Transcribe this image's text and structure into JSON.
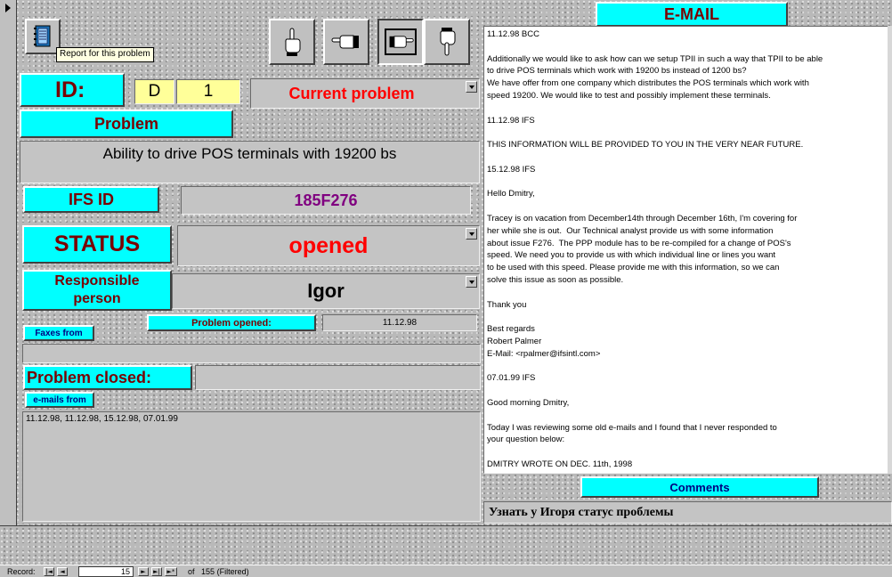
{
  "toolbar": {
    "tooltip": "Report for this problem",
    "buttons": [
      "report-book-icon",
      "pointing-hand-up-icon",
      "pointing-hand-left-icon",
      "pointing-hand-right-icon",
      "pointing-hand-down-icon"
    ]
  },
  "record": {
    "id_label": "ID:",
    "id_prefix": "D",
    "id_number": "1",
    "current_problem": "Current problem",
    "problem_label": "Problem",
    "problem_text": "Ability to drive POS terminals with 19200 bs",
    "ifs_id_label": "IFS ID",
    "ifs_id_value": "185F276",
    "status_label": "STATUS",
    "status_value": "opened",
    "responsible_label": "Responsible person",
    "responsible_value": "Igor",
    "problem_opened_label": "Problem opened:",
    "problem_opened_value": "11.12.98",
    "faxes_label": "Faxes from",
    "faxes_value": "",
    "problem_closed_label": "Problem closed:",
    "problem_closed_value": "",
    "emails_label": "e-mails from",
    "emails_value": "11.12.98, 11.12.98, 15.12.98, 07.01.99"
  },
  "email_panel": {
    "title": "E-MAIL",
    "body": "11.12.98 BCC\n\nAdditionally we would like to ask how can we setup TPII in such a way that TPII to be able\nto drive POS terminals which work with 19200 bs instead of 1200 bs?\nWe have offer from one company which distributes the POS terminals which work with\nspeed 19200. We would like to test and possibly implement these terminals.\n\n11.12.98 IFS\n\nTHIS INFORMATION WILL BE PROVIDED TO YOU IN THE VERY NEAR FUTURE.\n\n15.12.98 IFS\n\nHello Dmitry,\n\nTracey is on vacation from December14th through December 16th, I'm covering for\nher while she is out.  Our Technical analyst provide us with some information\nabout issue F276.  The PPP module has to be re-compiled for a change of POS's\nspeed. We need you to provide us with which individual line or lines you want\nto be used with this speed. Please provide me with this information, so we can\nsolve this issue as soon as possible.\n\nThank you\n\nBest regards\nRobert Palmer\nE-Mail: <rpalmer@ifsintl.com>\n\n07.01.99 IFS\n\nGood morning Dmitry,\n\nToday I was reviewing some old e-mails and I found that I never responded to\nyour question below:\n\nDMITRY WROTE ON DEC. 11th, 1998",
    "comments_label": "Comments",
    "comments_value": "Узнать у Игоря статус проблемы"
  },
  "navigation": {
    "record_label": "Record:",
    "current": "15",
    "of_label": "of",
    "total": "155",
    "filtered": "(Filtered)",
    "first": "|◄",
    "prev": "◄",
    "next": "►",
    "last": "►|",
    "new": "►*"
  },
  "colors": {
    "label_bg": "#00ffff",
    "label_text": "#7a0000",
    "highlight_red": "#ff0000",
    "ifs_purple": "#800080",
    "yellow_field": "#ffff99"
  }
}
